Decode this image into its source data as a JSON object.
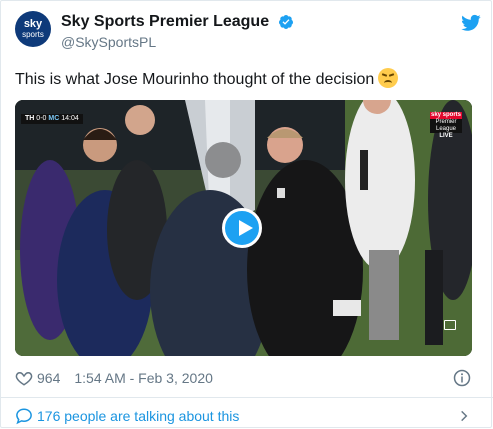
{
  "account": {
    "name": "Sky Sports Premier League",
    "handle": "@SkySportsPL",
    "avatar_top": "sky",
    "avatar_bottom": "sports"
  },
  "tweet": {
    "text": "This is what Jose Mourinho thought of the decision",
    "emoji": "face-with-steam-from-nose-emoji"
  },
  "video": {
    "score_home": "TH",
    "score": "0-0",
    "score_away": "MC",
    "clock": "14:04",
    "watermark_top": "sky sports",
    "watermark_mid": "Premier League",
    "watermark_live": "LIVE"
  },
  "meta": {
    "likes": "964",
    "timestamp": "1:54 AM - Feb 3, 2020"
  },
  "conversation": {
    "label": "176 people are talking about this"
  },
  "colors": {
    "accent": "#1da1f2",
    "link": "#1b95e0",
    "avatar_bg": "#0e3a7a",
    "muted": "#657786"
  }
}
